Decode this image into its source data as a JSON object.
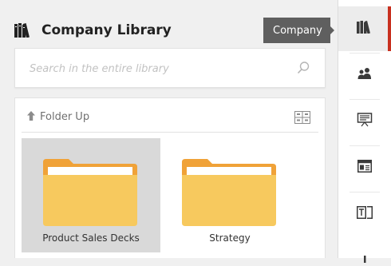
{
  "library": {
    "title": "Company Library",
    "title_icon": "books-icon"
  },
  "search": {
    "placeholder": "Search in the entire library",
    "icon": "search-icon"
  },
  "toolbar": {
    "folder_up_label": "Folder Up",
    "folder_up_icon": "arrow-up-icon",
    "view_toggle_icon": "grid-view-icon"
  },
  "folders": [
    {
      "name": "Product Sales Decks",
      "selected": true
    },
    {
      "name": "Strategy",
      "selected": false
    }
  ],
  "tooltip": {
    "text": "Company"
  },
  "rail": {
    "items": [
      {
        "icon": "books-icon",
        "active": true
      },
      {
        "icon": "people-icon",
        "active": false
      },
      {
        "icon": "presentation-icon",
        "active": false
      },
      {
        "icon": "layout-icon",
        "active": false
      },
      {
        "icon": "text-box-icon",
        "active": false
      },
      {
        "icon": "more-icon",
        "active": false
      }
    ]
  },
  "colors": {
    "accent": "#c8301f",
    "folder_back": "#f0a238",
    "folder_front": "#f7c95e",
    "selected_tile": "#d9d9d9"
  }
}
